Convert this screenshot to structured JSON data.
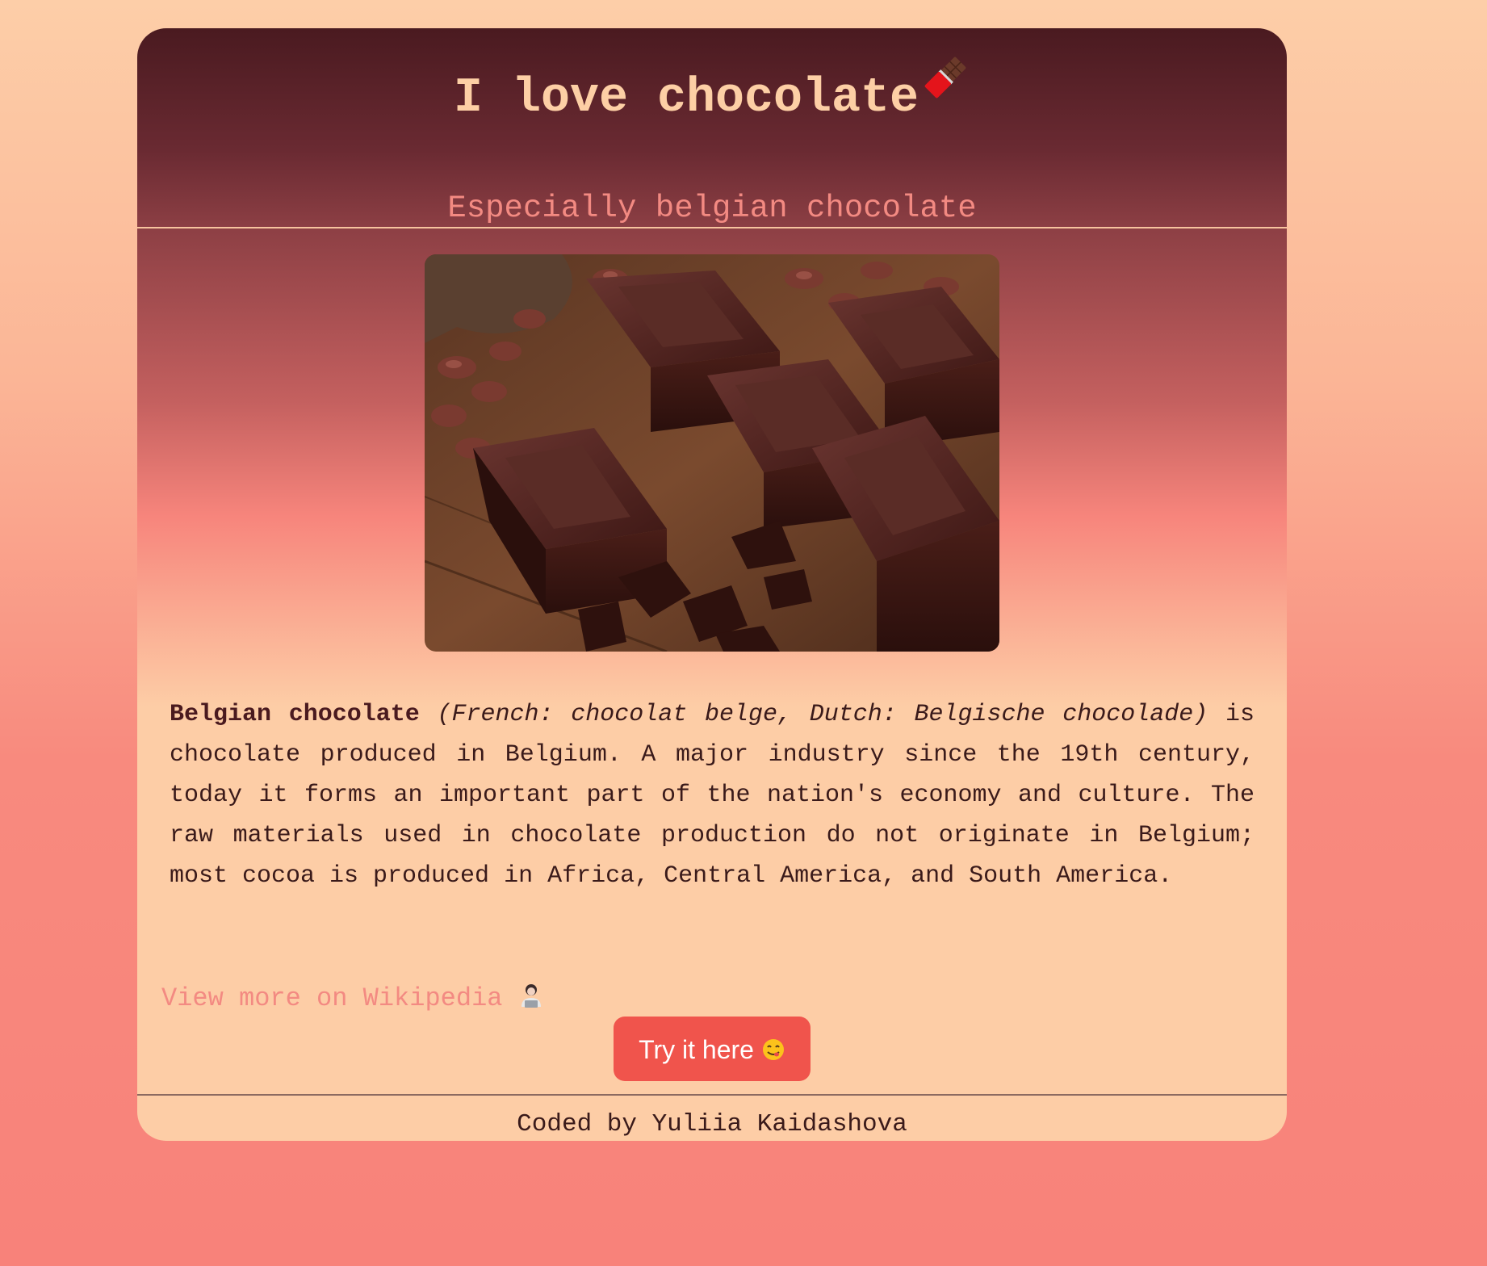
{
  "header": {
    "title": "I love chocolate",
    "title_icon": "chocolate-bar-icon",
    "subtitle": "Especially belgian chocolate"
  },
  "hero_image": {
    "subject": "pieces of dark chocolate on wooden table with cocoa beans"
  },
  "description": {
    "term": "Belgian chocolate",
    "translations": "(French: chocolat belge, Dutch: Belgische chocolade)",
    "body": " is chocolate produced in Belgium. A major industry since the 19th century, today it forms an important part of the nation's economy and culture. The raw materials used in chocolate production do not originate in Belgium; most cocoa is produced in Africa, Central America, and South America."
  },
  "wiki_link": {
    "label": "View more on Wikipedia",
    "icon": "technologist-icon"
  },
  "cta": {
    "label": "Try it here",
    "icon": "yum-face-icon"
  },
  "footer": {
    "credit": "Coded by Yuliia Kaidashova"
  },
  "colors": {
    "header_dark": "#4a1a20",
    "accent_salmon": "#f38a82",
    "button": "#f0544c",
    "card_light": "#fdcda6"
  }
}
